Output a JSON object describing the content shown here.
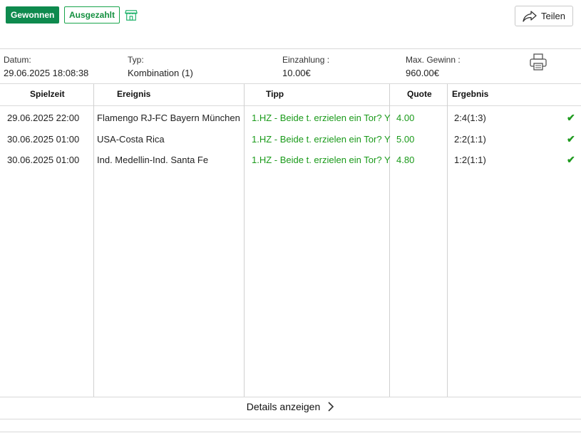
{
  "header": {
    "status_won": "Gewonnen",
    "status_paid": "Ausgezahlt",
    "share_label": "Teilen"
  },
  "meta": {
    "date_label": "Datum:",
    "date_value": "29.06.2025 18:08:38",
    "type_label": "Typ:",
    "type_value": "Kombination (1)",
    "stake_label": "Einzahlung :",
    "stake_value": "10.00€",
    "max_win_label": "Max. Gewinn :",
    "max_win_value": "960.00€"
  },
  "table": {
    "headers": {
      "time": "Spielzeit",
      "event": "Ereignis",
      "tip": "Tipp",
      "odds": "Quote",
      "result": "Ergebnis"
    },
    "rows": [
      {
        "time": "29.06.2025 22:00",
        "event": "Flamengo RJ-FC Bayern München",
        "tip": "1.HZ - Beide t. erzielen ein Tor? Y",
        "odds": "4.00",
        "result": "2:4(1:3)"
      },
      {
        "time": "30.06.2025 01:00",
        "event": "USA-Costa Rica",
        "tip": "1.HZ - Beide t. erzielen ein Tor? Y",
        "odds": "5.00",
        "result": "2:2(1:1)"
      },
      {
        "time": "30.06.2025 01:00",
        "event": "Ind. Medellin-Ind. Santa Fe",
        "tip": "1.HZ - Beide t. erzielen ein Tor? Y",
        "odds": "4.80",
        "result": "1:2(1:1)"
      }
    ]
  },
  "footer": {
    "details_label": "Details anzeigen"
  },
  "colors": {
    "won_badge": "#0e8a4e",
    "paid_border": "#19a54b",
    "tip_green": "#1a9a1a"
  }
}
